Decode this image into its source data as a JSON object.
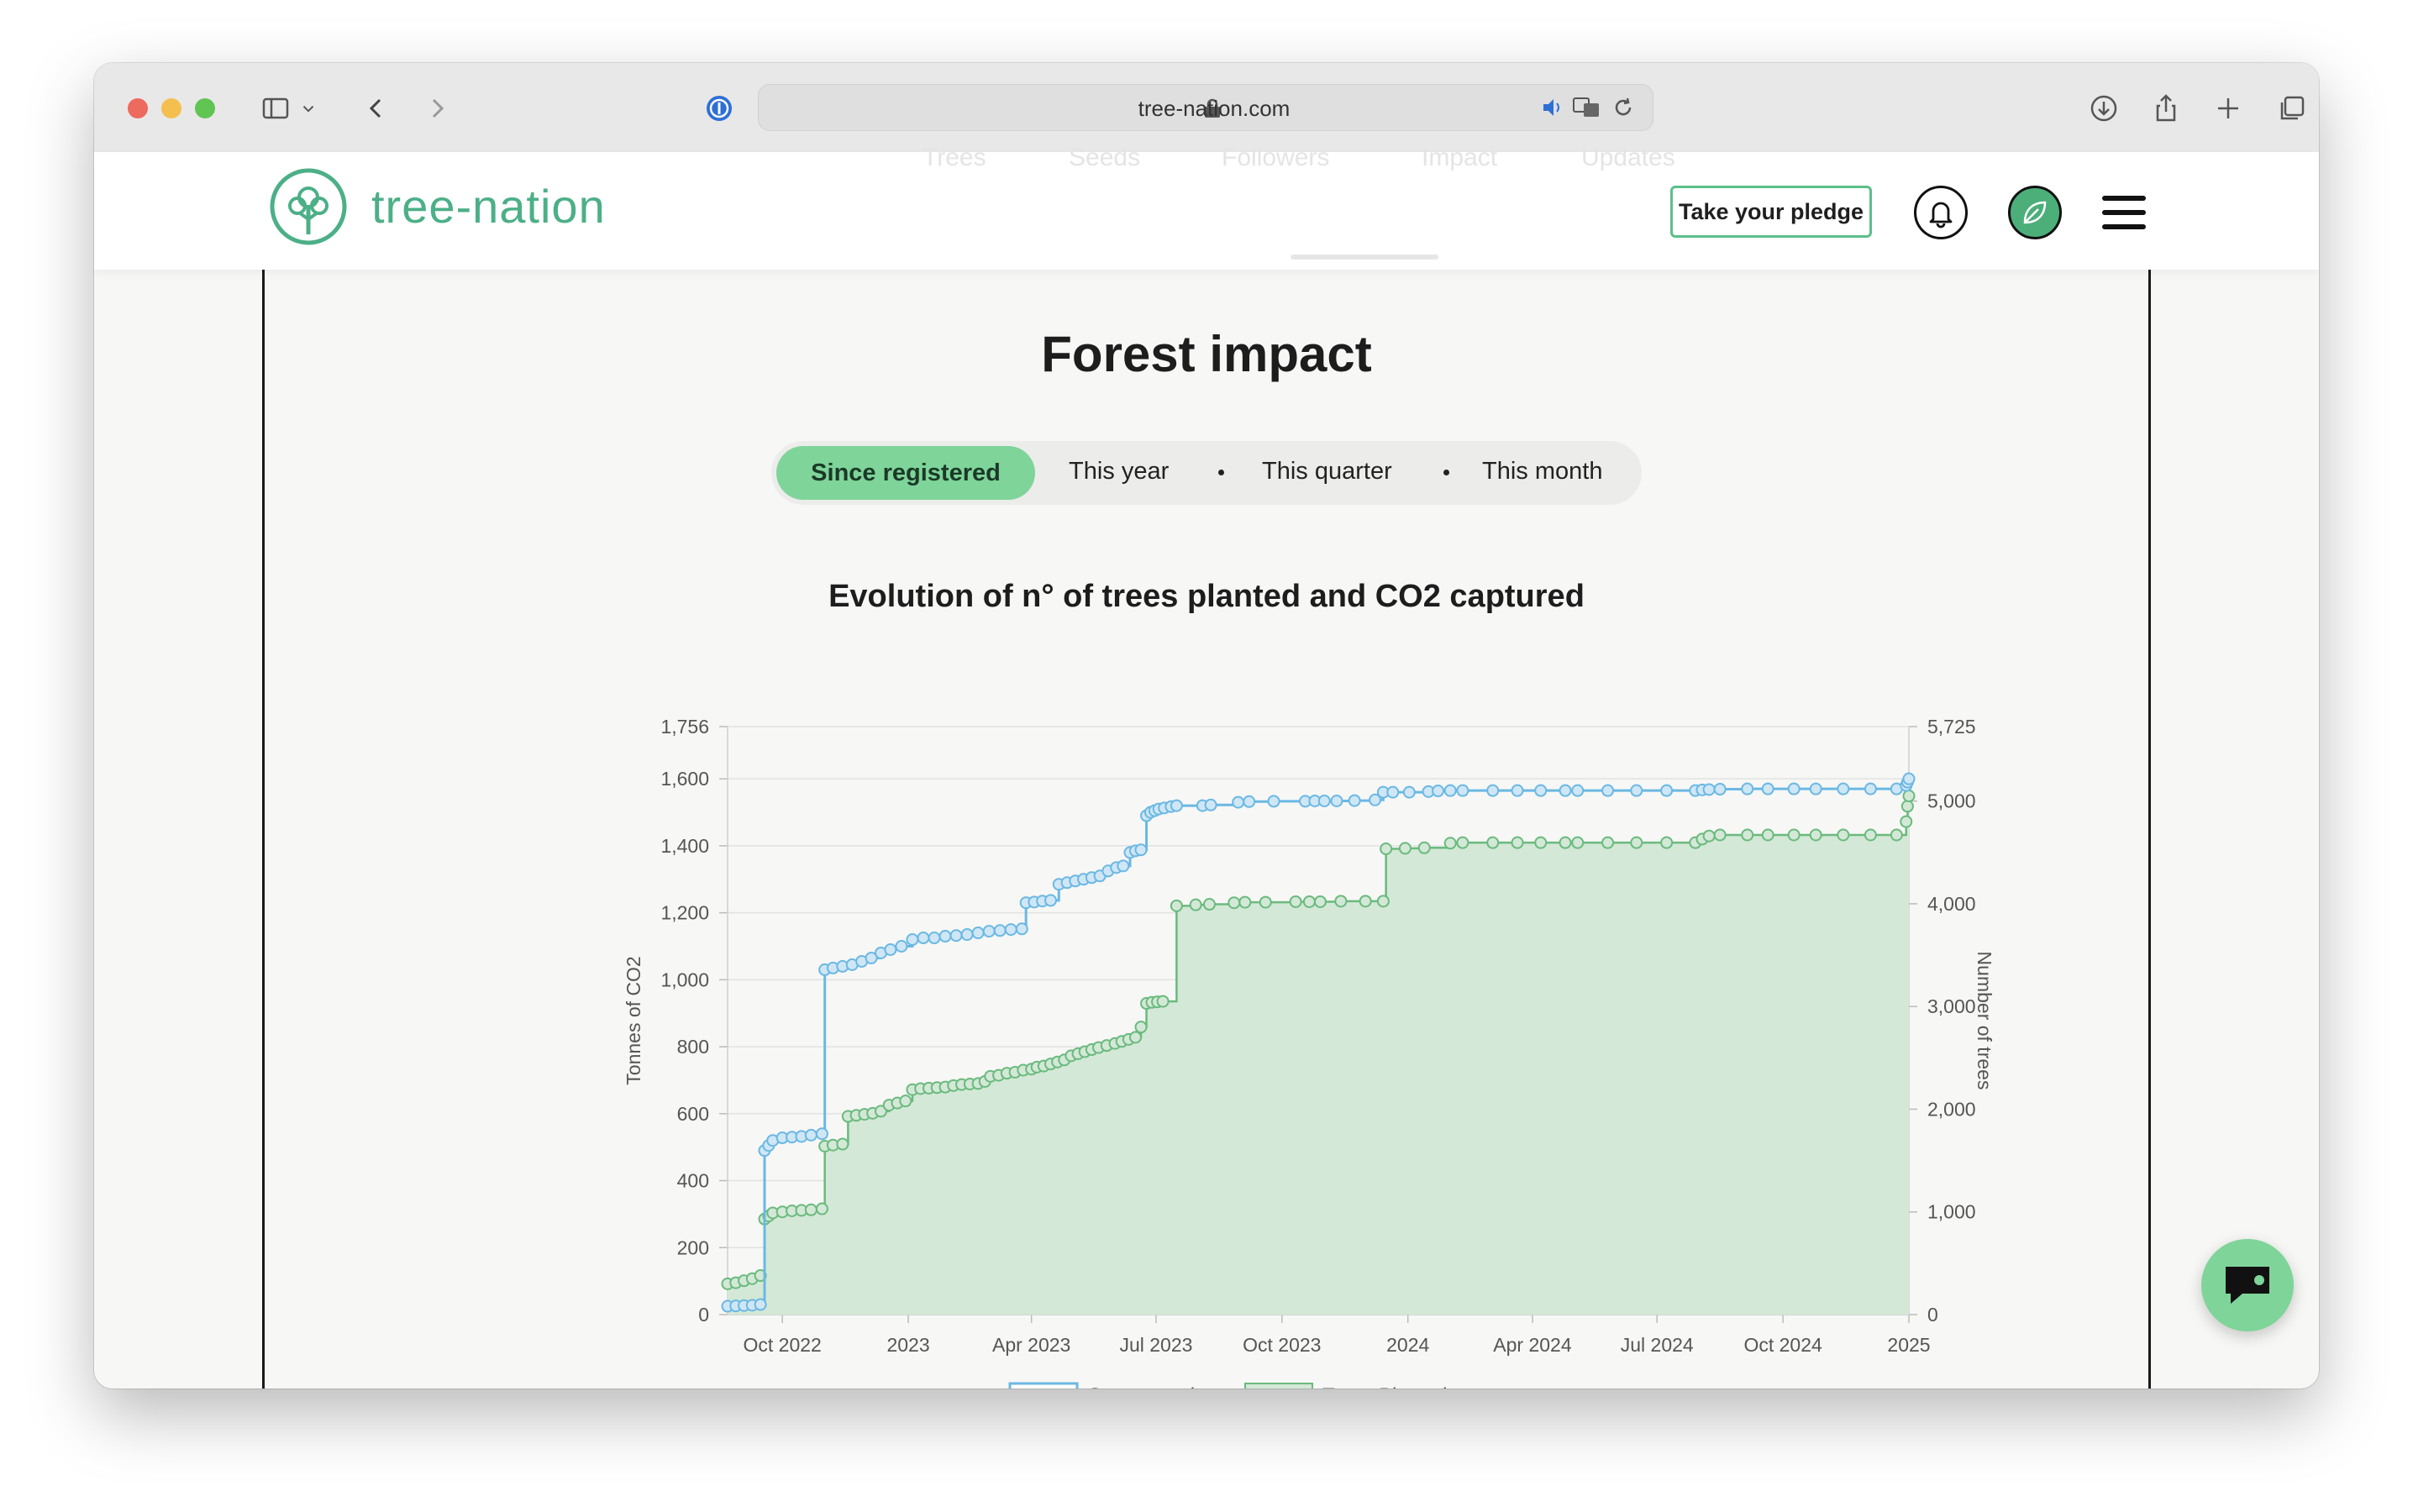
{
  "browser": {
    "url": "tree-nation.com"
  },
  "header": {
    "logo_text": "tree-nation",
    "ghost_tabs": [
      "Trees",
      "Seeds",
      "Followers",
      "Impact",
      "Updates"
    ],
    "pledge_label": "Take your pledge"
  },
  "section": {
    "title": "Forest impact"
  },
  "periods": {
    "active": "Since registered",
    "options": [
      "This year",
      "This quarter",
      "This month"
    ]
  },
  "chart_title": "Evolution of n° of trees planted and CO2 captured",
  "colors": {
    "compensation": "#6bb8e3",
    "trees_line": "#6aba7e",
    "trees_fill": "#d3e8d6",
    "accent": "#7fd49a",
    "brand": "#4caf88"
  },
  "chart_data": {
    "type": "line",
    "title": "Evolution of n° of trees planted and CO2 captured",
    "xlabel": "",
    "ylabel": "Tonnes of CO2",
    "y2label": "Number of trees",
    "ylim": [
      0,
      1756
    ],
    "y2lim": [
      0,
      5725
    ],
    "y_ticks": [
      "0",
      "200",
      "400",
      "600",
      "800",
      "1,000",
      "1,200",
      "1,400",
      "1,600",
      "1,756"
    ],
    "y_tick_values": [
      0,
      200,
      400,
      600,
      800,
      1000,
      1200,
      1400,
      1600,
      1756
    ],
    "y2_ticks": [
      "0",
      "1,000",
      "2,000",
      "3,000",
      "4,000",
      "5,000",
      "5,725"
    ],
    "y2_tick_values": [
      0,
      1000,
      2000,
      3000,
      4000,
      5000,
      5725
    ],
    "x_range": [
      "2022-08-22",
      "2025-01-01"
    ],
    "x_ticks": [
      {
        "label": "Oct 2022",
        "date": "2022-10-01"
      },
      {
        "label": "2023",
        "date": "2023-01-01"
      },
      {
        "label": "Apr 2023",
        "date": "2023-04-01"
      },
      {
        "label": "Jul 2023",
        "date": "2023-07-01"
      },
      {
        "label": "Oct 2023",
        "date": "2023-10-01"
      },
      {
        "label": "2024",
        "date": "2024-01-01"
      },
      {
        "label": "Apr 2024",
        "date": "2024-04-01"
      },
      {
        "label": "Jul 2024",
        "date": "2024-07-01"
      },
      {
        "label": "Oct 2024",
        "date": "2024-10-01"
      },
      {
        "label": "2025",
        "date": "2025-01-01"
      }
    ],
    "grid": true,
    "legend_position": "bottom",
    "series": [
      {
        "name": "Compensation",
        "axis": "left",
        "style": "step",
        "points": [
          [
            "2022-08-22",
            25
          ],
          [
            "2022-08-28",
            26
          ],
          [
            "2022-09-03",
            27
          ],
          [
            "2022-09-09",
            28
          ],
          [
            "2022-09-15",
            30
          ],
          [
            "2022-09-18",
            490
          ],
          [
            "2022-09-21",
            505
          ],
          [
            "2022-09-24",
            520
          ],
          [
            "2022-10-01",
            528
          ],
          [
            "2022-10-08",
            530
          ],
          [
            "2022-10-15",
            532
          ],
          [
            "2022-10-22",
            536
          ],
          [
            "2022-10-30",
            540
          ],
          [
            "2022-11-01",
            1030
          ],
          [
            "2022-11-07",
            1035
          ],
          [
            "2022-11-14",
            1040
          ],
          [
            "2022-11-21",
            1045
          ],
          [
            "2022-11-28",
            1055
          ],
          [
            "2022-12-05",
            1065
          ],
          [
            "2022-12-12",
            1080
          ],
          [
            "2022-12-19",
            1090
          ],
          [
            "2022-12-27",
            1100
          ],
          [
            "2023-01-04",
            1120
          ],
          [
            "2023-01-12",
            1125
          ],
          [
            "2023-01-20",
            1125
          ],
          [
            "2023-01-28",
            1130
          ],
          [
            "2023-02-05",
            1132
          ],
          [
            "2023-02-13",
            1135
          ],
          [
            "2023-02-21",
            1140
          ],
          [
            "2023-03-01",
            1145
          ],
          [
            "2023-03-09",
            1147
          ],
          [
            "2023-03-17",
            1150
          ],
          [
            "2023-03-25",
            1152
          ],
          [
            "2023-03-28",
            1230
          ],
          [
            "2023-04-03",
            1232
          ],
          [
            "2023-04-09",
            1235
          ],
          [
            "2023-04-15",
            1237
          ],
          [
            "2023-04-21",
            1285
          ],
          [
            "2023-04-27",
            1290
          ],
          [
            "2023-05-03",
            1295
          ],
          [
            "2023-05-09",
            1300
          ],
          [
            "2023-05-15",
            1305
          ],
          [
            "2023-05-21",
            1310
          ],
          [
            "2023-05-27",
            1325
          ],
          [
            "2023-06-02",
            1335
          ],
          [
            "2023-06-07",
            1340
          ],
          [
            "2023-06-12",
            1380
          ],
          [
            "2023-06-16",
            1385
          ],
          [
            "2023-06-20",
            1388
          ],
          [
            "2023-06-24",
            1490
          ],
          [
            "2023-06-27",
            1500
          ],
          [
            "2023-06-30",
            1505
          ],
          [
            "2023-07-03",
            1510
          ],
          [
            "2023-07-07",
            1513
          ],
          [
            "2023-07-12",
            1517
          ],
          [
            "2023-07-16",
            1520
          ],
          [
            "2023-08-04",
            1520
          ],
          [
            "2023-08-10",
            1522
          ],
          [
            "2023-08-30",
            1530
          ],
          [
            "2023-09-07",
            1532
          ],
          [
            "2023-09-25",
            1533
          ],
          [
            "2023-10-18",
            1533
          ],
          [
            "2023-10-25",
            1534
          ],
          [
            "2023-11-01",
            1534
          ],
          [
            "2023-11-10",
            1534
          ],
          [
            "2023-11-23",
            1535
          ],
          [
            "2023-12-08",
            1537
          ],
          [
            "2023-12-14",
            1560
          ],
          [
            "2023-12-21",
            1560
          ],
          [
            "2024-01-02",
            1560
          ],
          [
            "2024-01-16",
            1562
          ],
          [
            "2024-01-23",
            1564
          ],
          [
            "2024-02-01",
            1565
          ],
          [
            "2024-02-10",
            1565
          ],
          [
            "2024-03-03",
            1565
          ],
          [
            "2024-03-21",
            1565
          ],
          [
            "2024-04-07",
            1565
          ],
          [
            "2024-04-25",
            1565
          ],
          [
            "2024-05-04",
            1565
          ],
          [
            "2024-05-26",
            1565
          ],
          [
            "2024-06-16",
            1565
          ],
          [
            "2024-07-08",
            1565
          ],
          [
            "2024-07-29",
            1565
          ],
          [
            "2024-08-03",
            1567
          ],
          [
            "2024-08-08",
            1568
          ],
          [
            "2024-08-16",
            1569
          ],
          [
            "2024-09-05",
            1570
          ],
          [
            "2024-09-20",
            1570
          ],
          [
            "2024-10-09",
            1570
          ],
          [
            "2024-10-25",
            1570
          ],
          [
            "2024-11-14",
            1570
          ],
          [
            "2024-12-04",
            1570
          ],
          [
            "2024-12-23",
            1570
          ],
          [
            "2024-12-30",
            1580
          ],
          [
            "2024-12-31",
            1590
          ],
          [
            "2025-01-01",
            1600
          ]
        ]
      },
      {
        "name": "Trees Planted",
        "axis": "right",
        "style": "step",
        "points": [
          [
            "2022-08-22",
            300
          ],
          [
            "2022-08-28",
            310
          ],
          [
            "2022-09-03",
            330
          ],
          [
            "2022-09-09",
            350
          ],
          [
            "2022-09-15",
            380
          ],
          [
            "2022-09-18",
            930
          ],
          [
            "2022-09-21",
            960
          ],
          [
            "2022-09-24",
            990
          ],
          [
            "2022-10-01",
            1000
          ],
          [
            "2022-10-08",
            1010
          ],
          [
            "2022-10-15",
            1015
          ],
          [
            "2022-10-22",
            1020
          ],
          [
            "2022-10-30",
            1030
          ],
          [
            "2022-11-01",
            1640
          ],
          [
            "2022-11-07",
            1650
          ],
          [
            "2022-11-14",
            1660
          ],
          [
            "2022-11-18",
            1930
          ],
          [
            "2022-11-24",
            1940
          ],
          [
            "2022-11-30",
            1950
          ],
          [
            "2022-12-06",
            1960
          ],
          [
            "2022-12-12",
            1980
          ],
          [
            "2022-12-18",
            2040
          ],
          [
            "2022-12-24",
            2060
          ],
          [
            "2022-12-30",
            2080
          ],
          [
            "2023-01-04",
            2190
          ],
          [
            "2023-01-10",
            2200
          ],
          [
            "2023-01-16",
            2205
          ],
          [
            "2023-01-22",
            2210
          ],
          [
            "2023-01-28",
            2215
          ],
          [
            "2023-02-03",
            2230
          ],
          [
            "2023-02-09",
            2240
          ],
          [
            "2023-02-15",
            2245
          ],
          [
            "2023-02-21",
            2250
          ],
          [
            "2023-02-26",
            2270
          ],
          [
            "2023-03-02",
            2320
          ],
          [
            "2023-03-08",
            2330
          ],
          [
            "2023-03-14",
            2350
          ],
          [
            "2023-03-20",
            2360
          ],
          [
            "2023-03-26",
            2380
          ],
          [
            "2023-04-01",
            2390
          ],
          [
            "2023-04-05",
            2410
          ],
          [
            "2023-04-10",
            2420
          ],
          [
            "2023-04-15",
            2440
          ],
          [
            "2023-04-20",
            2460
          ],
          [
            "2023-04-25",
            2480
          ],
          [
            "2023-04-30",
            2520
          ],
          [
            "2023-05-05",
            2540
          ],
          [
            "2023-05-10",
            2560
          ],
          [
            "2023-05-15",
            2580
          ],
          [
            "2023-05-20",
            2600
          ],
          [
            "2023-05-26",
            2620
          ],
          [
            "2023-06-01",
            2640
          ],
          [
            "2023-06-06",
            2660
          ],
          [
            "2023-06-11",
            2680
          ],
          [
            "2023-06-16",
            2700
          ],
          [
            "2023-06-20",
            2800
          ],
          [
            "2023-06-24",
            3030
          ],
          [
            "2023-06-28",
            3040
          ],
          [
            "2023-07-02",
            3045
          ],
          [
            "2023-07-06",
            3050
          ],
          [
            "2023-07-16",
            3980
          ],
          [
            "2023-07-30",
            3990
          ],
          [
            "2023-08-09",
            3995
          ],
          [
            "2023-08-27",
            4010
          ],
          [
            "2023-09-04",
            4015
          ],
          [
            "2023-09-19",
            4015
          ],
          [
            "2023-10-11",
            4020
          ],
          [
            "2023-10-21",
            4020
          ],
          [
            "2023-10-29",
            4020
          ],
          [
            "2023-11-13",
            4025
          ],
          [
            "2023-12-01",
            4025
          ],
          [
            "2023-12-14",
            4025
          ],
          [
            "2023-12-16",
            4535
          ],
          [
            "2023-12-30",
            4540
          ],
          [
            "2024-01-13",
            4545
          ],
          [
            "2024-02-01",
            4590
          ],
          [
            "2024-02-10",
            4595
          ],
          [
            "2024-03-03",
            4595
          ],
          [
            "2024-03-21",
            4595
          ],
          [
            "2024-04-07",
            4595
          ],
          [
            "2024-04-25",
            4595
          ],
          [
            "2024-05-04",
            4595
          ],
          [
            "2024-05-26",
            4595
          ],
          [
            "2024-06-16",
            4595
          ],
          [
            "2024-07-08",
            4595
          ],
          [
            "2024-07-29",
            4595
          ],
          [
            "2024-08-03",
            4630
          ],
          [
            "2024-08-08",
            4660
          ],
          [
            "2024-08-16",
            4670
          ],
          [
            "2024-09-05",
            4670
          ],
          [
            "2024-09-20",
            4670
          ],
          [
            "2024-10-09",
            4670
          ],
          [
            "2024-10-25",
            4670
          ],
          [
            "2024-11-14",
            4670
          ],
          [
            "2024-12-04",
            4670
          ],
          [
            "2024-12-23",
            4670
          ],
          [
            "2024-12-30",
            4800
          ],
          [
            "2024-12-31",
            4950
          ],
          [
            "2025-01-01",
            5050
          ]
        ]
      }
    ]
  }
}
